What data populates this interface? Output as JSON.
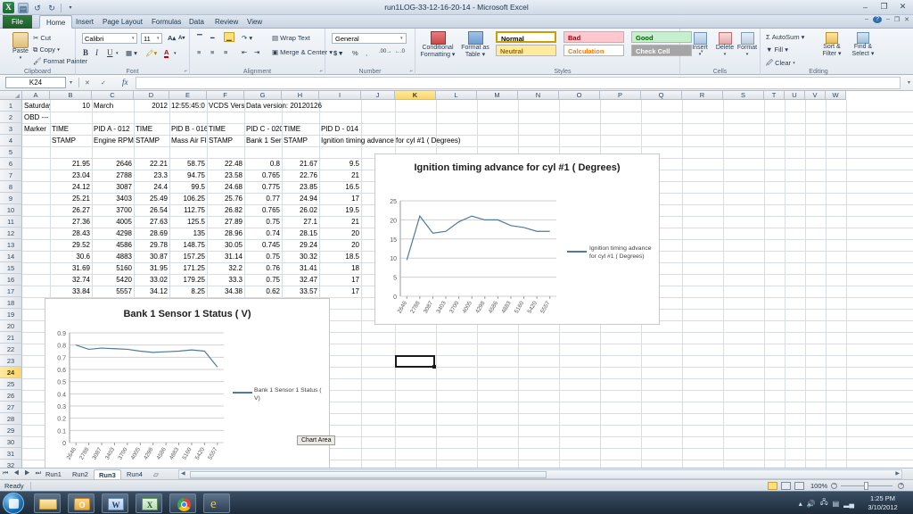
{
  "window": {
    "title": "run1LOG-33-12-16-20-14  -  Microsoft Excel",
    "app_logo": "excel-logo",
    "minimize": "–",
    "restore": "❐",
    "close": "✕",
    "help": "?",
    "ribbon_min": "–",
    "ribbon_opt": "❐",
    "ribbon_close": "✕",
    "qat": {
      "save": "💾",
      "undo": "↩",
      "redo": "↪",
      "more": "▾"
    }
  },
  "ribbon": {
    "tabs": [
      "File",
      "Home",
      "Insert",
      "Page Layout",
      "Formulas",
      "Data",
      "Review",
      "View"
    ],
    "active_tab": "Home",
    "groups": [
      {
        "name": "Clipboard",
        "label": "Clipboard",
        "items": [
          "Paste",
          "Cut",
          "Copy",
          "Format Painter"
        ]
      },
      {
        "name": "Font",
        "label": "Font",
        "font_name": "Calibri",
        "font_size": "11",
        "items": [
          "A",
          "A",
          "B",
          "I",
          "U"
        ]
      },
      {
        "name": "Alignment",
        "label": "Alignment",
        "items": [
          "Wrap Text",
          "Merge & Center"
        ]
      },
      {
        "name": "Number",
        "label": "Number",
        "format": "General",
        "items": [
          "$",
          "%",
          ",",
          ".00",
          ".0"
        ]
      },
      {
        "name": "Styles",
        "label": "Styles",
        "items": [
          "Conditional Formatting",
          "Format as Table"
        ],
        "cell_styles": [
          {
            "label": "Normal",
            "bg": "#ffffff",
            "fg": "#000000",
            "border": "#c8a000"
          },
          {
            "label": "Bad",
            "bg": "#ffc7ce",
            "fg": "#9c0006",
            "border": "#e0a0a8"
          },
          {
            "label": "Good",
            "bg": "#c6efce",
            "fg": "#006100",
            "border": "#a6cfae"
          },
          {
            "label": "Neutral",
            "bg": "#ffeb9c",
            "fg": "#9c6500",
            "border": "#dfc87c"
          },
          {
            "label": "Calculation",
            "bg": "#ffffff",
            "fg": "#fa7d00",
            "border": "#b0b0b0"
          },
          {
            "label": "Check Cell",
            "bg": "#a5a5a5",
            "fg": "#ffffff",
            "border": "#7f7f7f"
          }
        ]
      },
      {
        "name": "Cells",
        "label": "Cells",
        "items": [
          "Insert",
          "Delete",
          "Format"
        ]
      },
      {
        "name": "Editing",
        "label": "Editing",
        "items": [
          "AutoSum",
          "Fill",
          "Clear",
          "Sort & Filter",
          "Find & Select"
        ]
      }
    ]
  },
  "formula_bar": {
    "name_box": "K24",
    "formula": "",
    "fx_label": "fx",
    "dropdown": "▾",
    "expand": "▾"
  },
  "grid": {
    "columns": [
      "A",
      "B",
      "C",
      "D",
      "E",
      "F",
      "G",
      "H",
      "I",
      "J",
      "K",
      "L",
      "M",
      "N",
      "O",
      "P",
      "Q",
      "R",
      "S",
      "T",
      "U",
      "V",
      "W"
    ],
    "selected_column": "K",
    "selected_row": 24,
    "selected_cell": "K24",
    "rows": [
      1,
      2,
      3,
      4,
      5,
      6,
      7,
      8,
      9,
      10,
      11,
      12,
      13,
      14,
      15,
      16,
      17,
      18,
      19,
      20,
      21,
      22,
      23,
      24,
      25,
      26,
      27,
      28,
      29,
      30,
      31,
      32
    ],
    "cells": [
      {
        "col": "A",
        "row": 1,
        "value": "Saturday",
        "align": "left"
      },
      {
        "col": "B",
        "row": 1,
        "value": "10",
        "align": "right"
      },
      {
        "col": "C",
        "row": 1,
        "value": "March",
        "align": "left"
      },
      {
        "col": "D",
        "row": 1,
        "value": "2012",
        "align": "right"
      },
      {
        "col": "E",
        "row": 1,
        "value": "12:55:45:0",
        "align": "left"
      },
      {
        "col": "F",
        "row": 1,
        "value": "VCDS Vers",
        "align": "left"
      },
      {
        "col": "G",
        "row": 1,
        "value": "Data version: 20120126",
        "align": "left"
      },
      {
        "col": "A",
        "row": 2,
        "value": "OBD --- --- --",
        "align": "left"
      },
      {
        "col": "A",
        "row": 3,
        "value": "Marker",
        "align": "left"
      },
      {
        "col": "B",
        "row": 3,
        "value": "TIME",
        "align": "left"
      },
      {
        "col": "C",
        "row": 3,
        "value": "PID A - 012",
        "align": "left"
      },
      {
        "col": "D",
        "row": 3,
        "value": "TIME",
        "align": "left"
      },
      {
        "col": "E",
        "row": 3,
        "value": "PID B - 016",
        "align": "left"
      },
      {
        "col": "F",
        "row": 3,
        "value": "TIME",
        "align": "left"
      },
      {
        "col": "G",
        "row": 3,
        "value": "PID C - 020",
        "align": "left"
      },
      {
        "col": "H",
        "row": 3,
        "value": "TIME",
        "align": "left"
      },
      {
        "col": "I",
        "row": 3,
        "value": "PID D - 014",
        "align": "left"
      },
      {
        "col": "B",
        "row": 4,
        "value": "STAMP",
        "align": "left"
      },
      {
        "col": "C",
        "row": 4,
        "value": "Engine RPM",
        "align": "left"
      },
      {
        "col": "D",
        "row": 4,
        "value": "STAMP",
        "align": "left"
      },
      {
        "col": "E",
        "row": 4,
        "value": "Mass Air Fl",
        "align": "left"
      },
      {
        "col": "F",
        "row": 4,
        "value": "STAMP",
        "align": "left"
      },
      {
        "col": "G",
        "row": 4,
        "value": "Bank 1 Ser",
        "align": "left"
      },
      {
        "col": "H",
        "row": 4,
        "value": "STAMP",
        "align": "left"
      },
      {
        "col": "I",
        "row": 4,
        "value": "Ignition timing advance for cyl #1 ( Degrees)",
        "align": "left"
      }
    ],
    "data_rows": [
      {
        "row": 6,
        "B": "21.95",
        "C": "2646",
        "D": "22.21",
        "E": "58.75",
        "F": "22.48",
        "G": "0.8",
        "H": "21.67",
        "I": "9.5"
      },
      {
        "row": 7,
        "B": "23.04",
        "C": "2788",
        "D": "23.3",
        "E": "94.75",
        "F": "23.58",
        "G": "0.765",
        "H": "22.76",
        "I": "21"
      },
      {
        "row": 8,
        "B": "24.12",
        "C": "3087",
        "D": "24.4",
        "E": "99.5",
        "F": "24.68",
        "G": "0.775",
        "H": "23.85",
        "I": "16.5"
      },
      {
        "row": 9,
        "B": "25.21",
        "C": "3403",
        "D": "25.49",
        "E": "106.25",
        "F": "25.76",
        "G": "0.77",
        "H": "24.94",
        "I": "17"
      },
      {
        "row": 10,
        "B": "26.27",
        "C": "3700",
        "D": "26.54",
        "E": "112.75",
        "F": "26.82",
        "G": "0.765",
        "H": "26.02",
        "I": "19.5"
      },
      {
        "row": 11,
        "B": "27.36",
        "C": "4005",
        "D": "27.63",
        "E": "125.5",
        "F": "27.89",
        "G": "0.75",
        "H": "27.1",
        "I": "21"
      },
      {
        "row": 12,
        "B": "28.43",
        "C": "4298",
        "D": "28.69",
        "E": "135",
        "F": "28.96",
        "G": "0.74",
        "H": "28.15",
        "I": "20"
      },
      {
        "row": 13,
        "B": "29.52",
        "C": "4586",
        "D": "29.78",
        "E": "148.75",
        "F": "30.05",
        "G": "0.745",
        "H": "29.24",
        "I": "20"
      },
      {
        "row": 14,
        "B": "30.6",
        "C": "4883",
        "D": "30.87",
        "E": "157.25",
        "F": "31.14",
        "G": "0.75",
        "H": "30.32",
        "I": "18.5"
      },
      {
        "row": 15,
        "B": "31.69",
        "C": "5160",
        "D": "31.95",
        "E": "171.25",
        "F": "32.2",
        "G": "0.76",
        "H": "31.41",
        "I": "18"
      },
      {
        "row": 16,
        "B": "32.74",
        "C": "5420",
        "D": "33.02",
        "E": "179.25",
        "F": "33.3",
        "G": "0.75",
        "H": "32.47",
        "I": "17"
      },
      {
        "row": 17,
        "B": "33.84",
        "C": "5557",
        "D": "34.12",
        "E": "8.25",
        "F": "34.38",
        "G": "0.62",
        "H": "33.57",
        "I": "17"
      }
    ]
  },
  "chart_data": [
    {
      "id": "ignition",
      "type": "line",
      "title": "Ignition timing advance for cyl #1 ( Degrees)",
      "categories": [
        "2646",
        "2788",
        "3087",
        "3403",
        "3700",
        "4005",
        "4298",
        "4586",
        "4883",
        "5160",
        "5420",
        "5557"
      ],
      "series": [
        {
          "name": "Ignition timing advance for cyl #1 ( Degrees)",
          "values": [
            9.5,
            21,
            16.5,
            17,
            19.5,
            21,
            20,
            20,
            18.5,
            18,
            17,
            17
          ],
          "color": "#4e7a9e"
        }
      ],
      "ylim": [
        0,
        25
      ],
      "yticks": [
        "0",
        "5",
        "10",
        "15",
        "20",
        "25"
      ],
      "xlabel": "",
      "ylabel": "",
      "grid": true,
      "legend_position": "right"
    },
    {
      "id": "bank1sensor",
      "type": "line",
      "title": "Bank 1 Sensor 1 Status ( V)",
      "categories": [
        "2646",
        "2788",
        "3087",
        "3403",
        "3700",
        "4005",
        "4298",
        "4586",
        "4883",
        "5160",
        "5420",
        "5557"
      ],
      "series": [
        {
          "name": "Bank 1 Sensor 1 Status ( V)",
          "values": [
            0.8,
            0.765,
            0.775,
            0.77,
            0.765,
            0.75,
            0.74,
            0.745,
            0.75,
            0.76,
            0.75,
            0.62
          ],
          "color": "#4e7a9e"
        }
      ],
      "ylim": [
        0,
        0.9
      ],
      "yticks": [
        "0",
        "0.1",
        "0.2",
        "0.3",
        "0.4",
        "0.5",
        "0.6",
        "0.7",
        "0.8",
        "0.9"
      ],
      "xlabel": "",
      "ylabel": "",
      "grid": true,
      "legend_position": "right"
    }
  ],
  "tooltip": {
    "text": "Chart Area"
  },
  "sheet_tabs": {
    "nav": "◀◀ ◀ ▶ ▶▶",
    "tabs": [
      "Run1",
      "Run2",
      "Run3",
      "Run4"
    ],
    "active": "Run3",
    "new_sheet": "＋"
  },
  "status_bar": {
    "state": "Ready",
    "views": [
      "normal-view",
      "page-layout-view",
      "page-break-view"
    ],
    "active_view": "normal-view",
    "zoom": "100%"
  },
  "taskbar": {
    "start": "start-orb",
    "items": [
      "explorer-icon",
      "outlook-icon",
      "word-icon",
      "excel-icon",
      "chrome-icon",
      "ie-icon"
    ],
    "tray": [
      "show-hidden-icon",
      "volume-icon",
      "network-icon",
      "action-center-icon",
      "signal-icon"
    ],
    "clock_time": "1:25 PM",
    "clock_date": "3/10/2012"
  }
}
